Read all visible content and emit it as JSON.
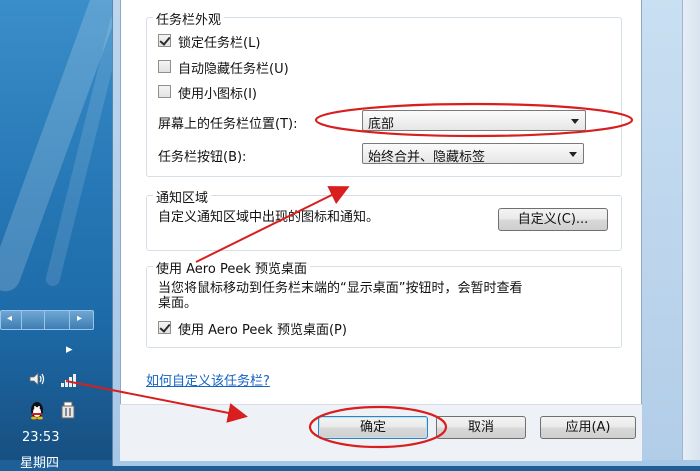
{
  "tray": {
    "clock_time": "23:53",
    "clock_day": "星期四",
    "icons": [
      "volume-icon",
      "signal-icon",
      "qq-icon",
      "device-icon"
    ]
  },
  "appearance": {
    "legend": "任务栏外观",
    "lock_taskbar": {
      "label": "锁定任务栏(L)",
      "checked": true
    },
    "auto_hide": {
      "label": "自动隐藏任务栏(U)",
      "checked": false
    },
    "small_icons": {
      "label": "使用小图标(I)",
      "checked": false
    },
    "location": {
      "label": "屏幕上的任务栏位置(T):",
      "value": "底部"
    },
    "buttons": {
      "label": "任务栏按钮(B):",
      "value": "始终合并、隐藏标签"
    }
  },
  "notification": {
    "legend": "通知区域",
    "text": "自定义通知区域中出现的图标和通知。",
    "customize_button": "自定义(C)..."
  },
  "aero_peek": {
    "legend": "使用 Aero Peek 预览桌面",
    "description_line1": "当您将鼠标移动到任务栏末端的“显示桌面”按钮时，会暂时查看",
    "description_line2": "桌面。",
    "checkbox": {
      "label": "使用 Aero Peek 预览桌面(P)",
      "checked": true
    }
  },
  "help_link": "如何自定义该任务栏?",
  "footer": {
    "ok": "确定",
    "cancel": "取消",
    "apply": "应用(A)"
  },
  "colors": {
    "annotation": "#d81e1e",
    "link": "#1563c5"
  }
}
